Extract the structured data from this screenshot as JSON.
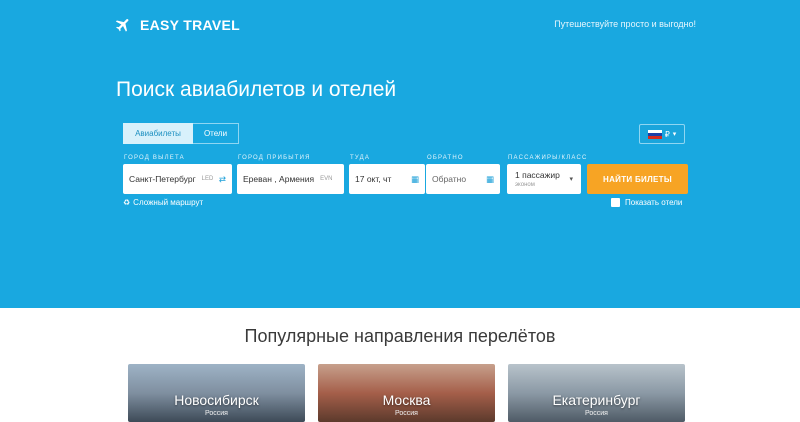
{
  "header": {
    "logo_text": "EASY TRAVEL",
    "tagline": "Путешествуйте просто и выгодно!"
  },
  "hero": {
    "title": "Поиск авиабилетов и отелей"
  },
  "tabs": [
    {
      "label": "Авиабилеты",
      "active": true
    },
    {
      "label": "Отели",
      "active": false
    }
  ],
  "currency": {
    "symbol": "₽",
    "flag": "russia-flag"
  },
  "form": {
    "from_label": "Город вылета",
    "from_value": "Санкт-Петербург",
    "from_code": "LED",
    "to_label": "Город прибытия",
    "to_value": "Ереван , Армения",
    "to_code": "EVN",
    "there_label": "Туда",
    "there_value": "17 окт, чт",
    "back_label": "Обратно",
    "back_placeholder": "Обратно",
    "passengers_label": "Пассажиры/класс",
    "passengers_value": "1 пассажир",
    "class_value": "эконом",
    "search_button": "НАЙТИ БИЛЕТЫ",
    "complex_route": "Сложный маршрут",
    "show_hotels": "Показать отели"
  },
  "popular": {
    "title": "Популярные направления перелётов",
    "cards": [
      {
        "city": "Новосибирск",
        "country": "Россия"
      },
      {
        "city": "Москва",
        "country": "Россия"
      },
      {
        "city": "Екатеринбург",
        "country": "Россия"
      }
    ]
  },
  "colors": {
    "hero_bg": "#19a8e0",
    "accent_button": "#f7a424",
    "icon_blue": "#1b9fd8"
  }
}
